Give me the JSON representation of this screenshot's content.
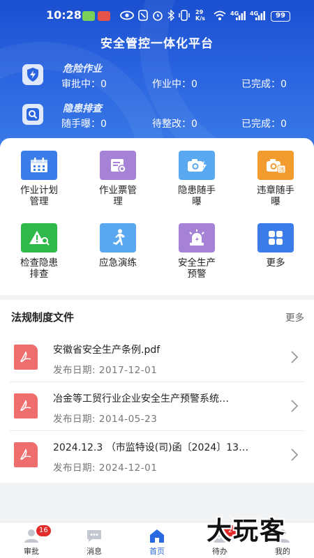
{
  "status_bar": {
    "time": "10:28",
    "network_speed": "29 K/s",
    "signal_1": "4G",
    "signal_2": "4G",
    "battery": "99"
  },
  "app_title": "安全管控一体化平台",
  "stats": [
    {
      "title": "危险作业",
      "icon": "shield-lightning-icon",
      "items": [
        {
          "label": "审批中：",
          "value": "0"
        },
        {
          "label": "作业中：",
          "value": "0"
        },
        {
          "label": "已完成：",
          "value": "0"
        }
      ]
    },
    {
      "title": "隐患排查",
      "icon": "search-icon",
      "items": [
        {
          "label": "随手曝：",
          "value": "0"
        },
        {
          "label": "待整改：",
          "value": "0"
        },
        {
          "label": "已完成：",
          "value": "0"
        }
      ]
    }
  ],
  "grid": [
    {
      "line1": "作业计划",
      "line2": "管理",
      "icon": "calendar-icon",
      "color": "#3b7de8"
    },
    {
      "line1": "作业票管",
      "line2": "理",
      "icon": "ticket-settings-icon",
      "color": "#a682d6"
    },
    {
      "line1": "隐患随手",
      "line2": "曝",
      "icon": "camera-icon",
      "color": "#5aa9f0"
    },
    {
      "line1": "违章随手",
      "line2": "曝",
      "icon": "camera-violation-icon",
      "color": "#f29b2e"
    },
    {
      "line1": "检查隐患",
      "line2": "排查",
      "icon": "warning-search-icon",
      "color": "#2fb94a"
    },
    {
      "line1": "应急演练",
      "line2": "",
      "icon": "running-man-icon",
      "color": "#5aa9f0"
    },
    {
      "line1": "安全生产",
      "line2": "预警",
      "icon": "alarm-light-icon",
      "color": "#a682d6"
    },
    {
      "line1": "更多",
      "line2": "",
      "icon": "grid-more-icon",
      "color": "#3b7de8"
    }
  ],
  "laws": {
    "heading": "法规制度文件",
    "more": "更多",
    "docs": [
      {
        "title": "安徽省安全生产条例.pdf",
        "date_label": "发布日期:",
        "date": "2017-12-01"
      },
      {
        "title": "冶金等工贸行业企业安全生产预警系统…",
        "date_label": "发布日期:",
        "date": "2014-05-23"
      },
      {
        "title": "2024.12.3 （市监特设(司)函〔2024〕13…",
        "date_label": "发布日期:",
        "date": "2024-12-01"
      }
    ]
  },
  "tabs": [
    {
      "label": "审批",
      "icon": "approval-icon",
      "badge": "16"
    },
    {
      "label": "消息",
      "icon": "message-icon",
      "badge": ""
    },
    {
      "label": "首页",
      "icon": "home-icon",
      "badge": "",
      "active": true
    },
    {
      "label": "待办",
      "icon": "todo-icon",
      "badge": "2"
    },
    {
      "label": "我的",
      "icon": "profile-icon",
      "badge": ""
    }
  ],
  "watermark": "大玩客"
}
